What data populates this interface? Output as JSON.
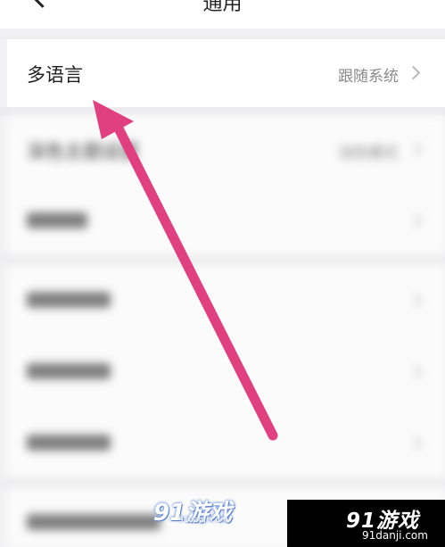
{
  "header": {
    "title": "通用"
  },
  "settings": {
    "language": {
      "label": "多语言",
      "value": "跟随系统"
    },
    "dark_theme": {
      "label": "深色主题设置",
      "value": "浅色模式"
    }
  },
  "watermarks": {
    "center_logo": "91游戏",
    "center_url": "91danji.com",
    "corner_logo": "91游戏",
    "corner_url": "91danji.com"
  },
  "annotation": {
    "arrow_color": "#e0407f"
  }
}
